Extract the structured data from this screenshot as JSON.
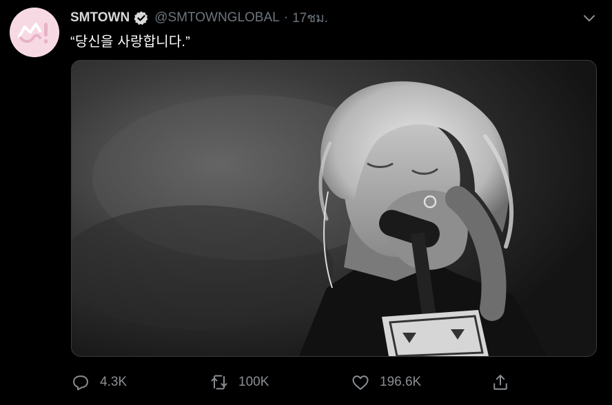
{
  "tweet": {
    "author_name": "SMTOWN",
    "handle": "@SMTOWNGLOBAL",
    "separator": "·",
    "time": "17ชม.",
    "text": "“당신을 사랑합니다.”",
    "verified": true
  },
  "actions": {
    "reply_count": "4.3K",
    "retweet_count": "100K",
    "like_count": "196.6K"
  },
  "icons": {
    "avatar": "smtown-logo-icon",
    "verified": "verified-badge-icon",
    "menu": "chevron-down-icon",
    "reply": "reply-icon",
    "retweet": "retweet-icon",
    "like": "heart-icon",
    "share": "share-icon"
  },
  "colors": {
    "background": "#000000",
    "text_primary": "#ffffff",
    "text_secondary": "#6e767d",
    "avatar_bg": "#f7d9e4",
    "logo": "#e8b2c6"
  }
}
